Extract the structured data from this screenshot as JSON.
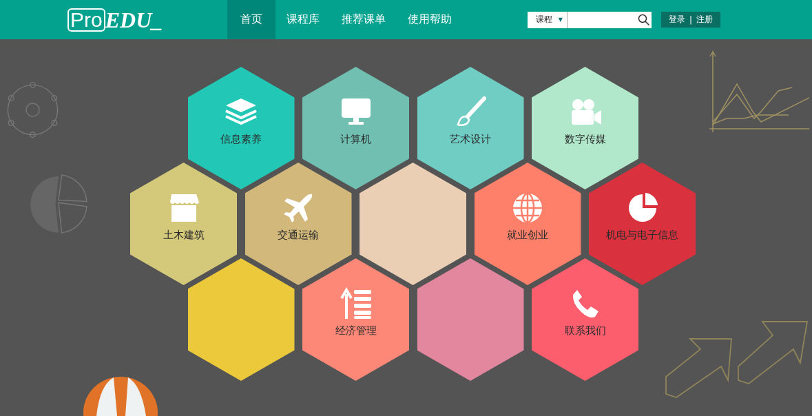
{
  "header": {
    "logo": {
      "part_1": "Pro",
      "part_2": "EDU_"
    },
    "nav": [
      {
        "label": "首页",
        "selected": true
      },
      {
        "label": "课程库",
        "selected": false
      },
      {
        "label": "推荐课单",
        "selected": false
      },
      {
        "label": "使用帮助",
        "selected": false
      }
    ],
    "search": {
      "scope": "课程",
      "caret": "▼"
    },
    "account": {
      "login": "登录",
      "separator": "|",
      "register": "注册"
    }
  },
  "tile_rows": [
    {
      "tiles": [
        {
          "label": "信息素养",
          "color": "#22c7b5"
        },
        {
          "label": "计算机",
          "color": "#70bfb1"
        },
        {
          "label": "艺术设计",
          "color": "#70cdc4"
        },
        {
          "label": "数字传媒",
          "color": "#b1e8cb"
        }
      ]
    },
    {
      "tiles": [
        {
          "label": "土木建筑",
          "color": "#d4c87b"
        },
        {
          "label": "交通运输",
          "color": "#d2b87a"
        },
        {
          "color": "#eacfb5"
        },
        {
          "label": "就业创业",
          "color": "#fe806a"
        },
        {
          "label": "机电与电子信息",
          "color": "#d9323e"
        }
      ]
    },
    {
      "tiles": [
        {
          "color": "#ecc93b"
        },
        {
          "label": "经济管理",
          "color": "#fe8877"
        },
        {
          "color": "#e3879f"
        },
        {
          "label": "联系我们",
          "color": "#fd5e6d"
        }
      ]
    }
  ]
}
